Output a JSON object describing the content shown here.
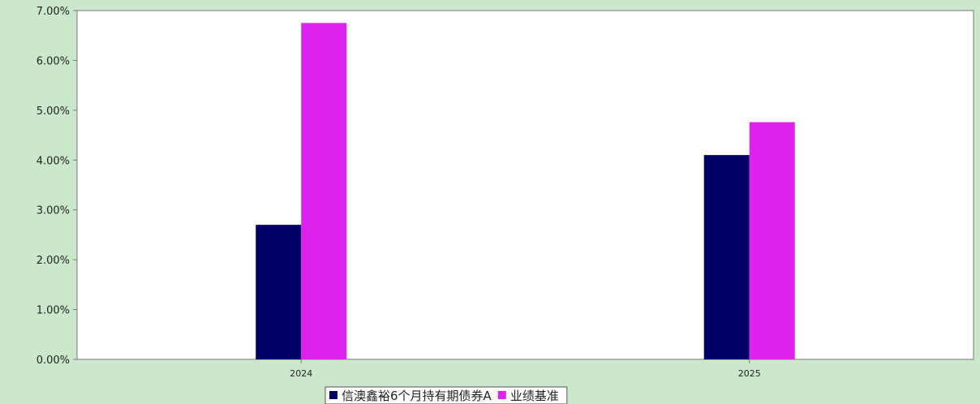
{
  "chart_data": {
    "type": "bar",
    "title": "",
    "xlabel": "",
    "ylabel": "",
    "categories": [
      "2024",
      "2025"
    ],
    "series": [
      {
        "name": "信澳鑫裕6个月持有期债券A",
        "values": [
          2.7,
          4.1
        ],
        "color": "#000066"
      },
      {
        "name": "业绩基准",
        "values": [
          6.75,
          4.76
        ],
        "color": "#dd22ee"
      }
    ],
    "ylim": [
      0,
      7
    ],
    "yticks": [
      "0.00%",
      "1.00%",
      "2.00%",
      "3.00%",
      "4.00%",
      "5.00%",
      "6.00%",
      "7.00%"
    ],
    "grid": false,
    "legend": "bottom-center"
  },
  "colors": {
    "background": "#cce8cc",
    "plot_background": "#ffffff",
    "axis": "#7a7a7a"
  }
}
